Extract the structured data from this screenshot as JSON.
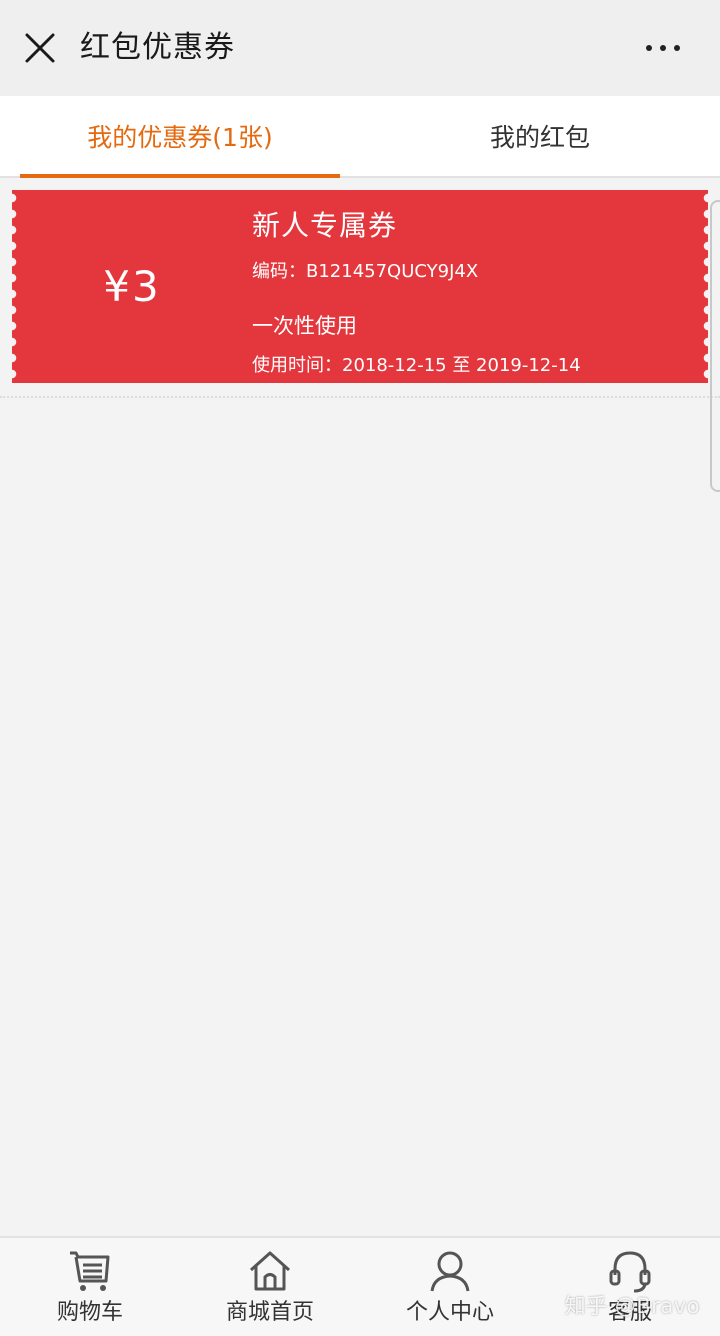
{
  "header": {
    "title": "红包优惠券",
    "close_icon": "close-icon",
    "more_icon": "more-icon"
  },
  "tabs": [
    {
      "label": "我的优惠券(1张)",
      "active": true
    },
    {
      "label": "我的红包",
      "active": false
    }
  ],
  "coupon": {
    "amount": "¥3",
    "title": "新人专属券",
    "code": "编码：B121457QUCY9J4X",
    "usage": "一次性使用",
    "validity": "使用时间：2018-12-15 至 2019-12-14",
    "color": "#e4363d"
  },
  "bottom_nav": [
    {
      "label": "购物车",
      "icon": "cart-icon"
    },
    {
      "label": "商城首页",
      "icon": "home-icon"
    },
    {
      "label": "个人中心",
      "icon": "user-icon"
    },
    {
      "label": "客服",
      "icon": "headset-icon"
    }
  ],
  "watermark": "知乎 @Bravo",
  "colors": {
    "accent": "#e4690f",
    "coupon": "#e4363d"
  }
}
